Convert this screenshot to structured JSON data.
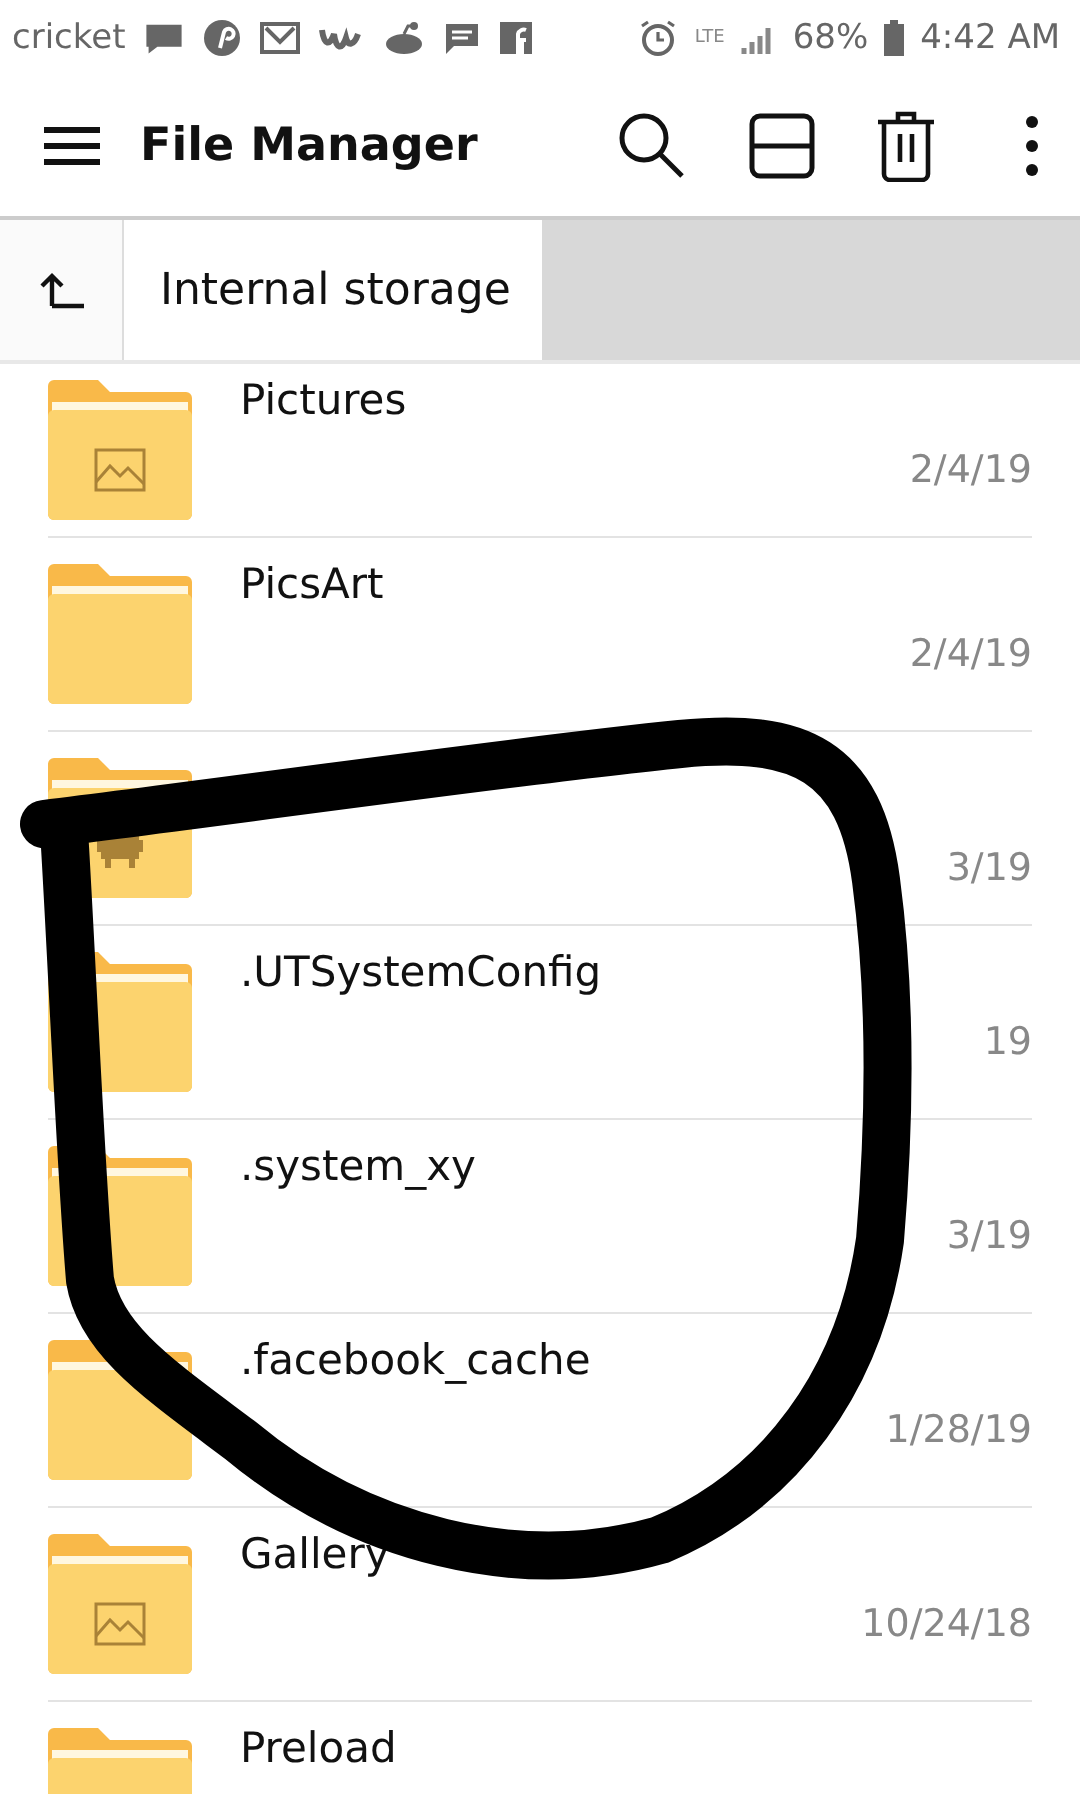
{
  "status_bar": {
    "carrier": "cricket",
    "network": "LTE",
    "battery": "68%",
    "time": "4:42 AM"
  },
  "toolbar": {
    "title": "File Manager"
  },
  "breadcrumb": {
    "path": "Internal storage"
  },
  "files": [
    {
      "name": "Pictures",
      "date": "2/4/19",
      "kind": "image"
    },
    {
      "name": "PicsArt",
      "date": "2/4/19",
      "kind": "plain"
    },
    {
      "date": "3/19",
      "kind": "android"
    },
    {
      "name": ".UTSystemConfig",
      "date": "19",
      "kind": "plain"
    },
    {
      "name": ".system_xy",
      "date": "3/19",
      "kind": "plain"
    },
    {
      "name": ".facebook_cache",
      "date": "1/28/19",
      "kind": "plain"
    },
    {
      "name": "Gallery",
      "date": "10/24/18",
      "kind": "image"
    },
    {
      "name": "Preload",
      "kind": "plain"
    }
  ]
}
